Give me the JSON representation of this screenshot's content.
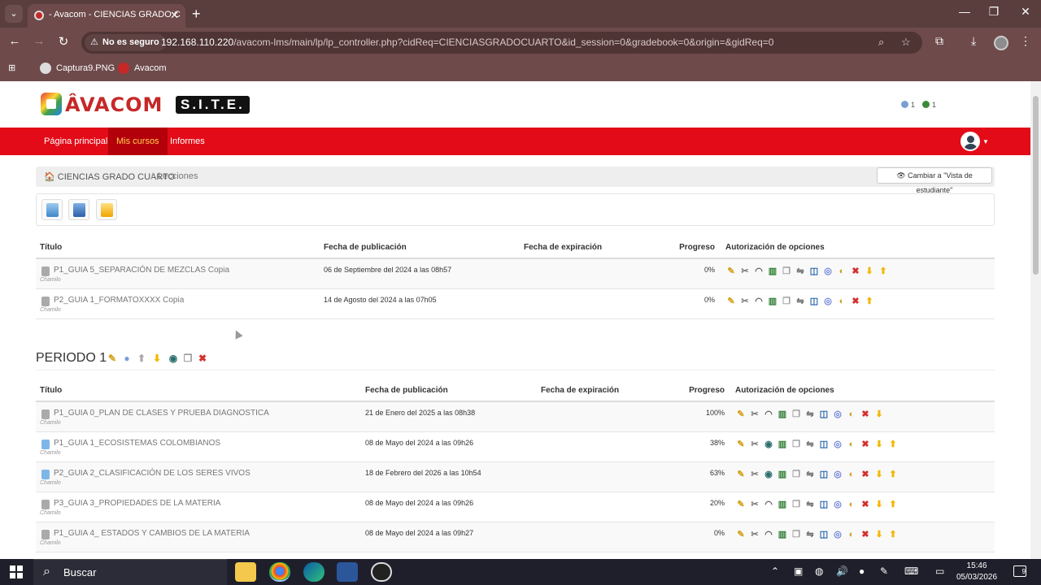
{
  "browser": {
    "tab_title": "- Avacom - CIENCIAS GRADO C",
    "new_tab": "+",
    "security_label": "No es seguro",
    "url_host": "192.168.110.220",
    "url_path": "/avacom-lms/main/lp/lp_controller.php?cidReq=CIENCIASGRADOCUARTO&id_session=0&gradebook=0&origin=&gidReq=0",
    "bookmarks": [
      "Captura9.PNG",
      "Avacom"
    ]
  },
  "site": {
    "logo_word": "ÂVACOM",
    "logo_site": "S.I.T.E.",
    "indicators": [
      "1",
      "1"
    ],
    "nav": [
      "Página principal",
      "Mis cursos",
      "Informes"
    ],
    "breadcrumb": [
      "CIENCIAS GRADO CUARTO",
      "Lecciones"
    ],
    "student_view_button": "👁 Cambiar a \"Vista de estudiante\""
  },
  "table_headers": [
    "Título",
    "Fecha de publicación",
    "Fecha de expiración",
    "Progreso",
    "Autorización de opciones"
  ],
  "author": "Chamilo",
  "ungrouped": [
    {
      "title": "P1_GUIA 5_SEPARACIÓN DE MEZCLAS Copia",
      "published": "06 de Septiembre del 2024 a las 08h57",
      "progress": "0%"
    },
    {
      "title": "P2_GUIA 1_FORMATOXXXX Copia",
      "published": "14 de Agosto del 2024 a las 07h05",
      "progress": "0%"
    }
  ],
  "period": {
    "title": "PERIODO 1",
    "rows": [
      {
        "title": "P1_GUIA 0_PLAN DE CLASES Y PRUEBA DIAGNOSTICA",
        "published": "21 de Enero del 2025 a las 08h38",
        "progress": "100%"
      },
      {
        "title": "P1_GUIA 1_ECOSISTEMAS COLOMBIANOS",
        "published": "08 de Mayo del 2024 a las 09h26",
        "progress": "38%"
      },
      {
        "title": "P2_GUIA 2_CLASIFICACIÓN DE LOS SERES VIVOS",
        "published": "18 de Febrero del 2026 a las 10h54",
        "progress": "63%"
      },
      {
        "title": "P3_GUIA 3_PROPIEDADES DE LA MATERIA",
        "published": "08 de Mayo del 2024 a las 09h26",
        "progress": "20%"
      },
      {
        "title": "P1_GUIA 4_ ESTADOS Y CAMBIOS DE LA MATERIA",
        "published": "08 de Mayo del 2024 a las 09h27",
        "progress": "0%"
      }
    ]
  },
  "taskbar": {
    "search_label": "Buscar",
    "time": "15:46",
    "date": "05/03/2026",
    "notifications": "9"
  }
}
